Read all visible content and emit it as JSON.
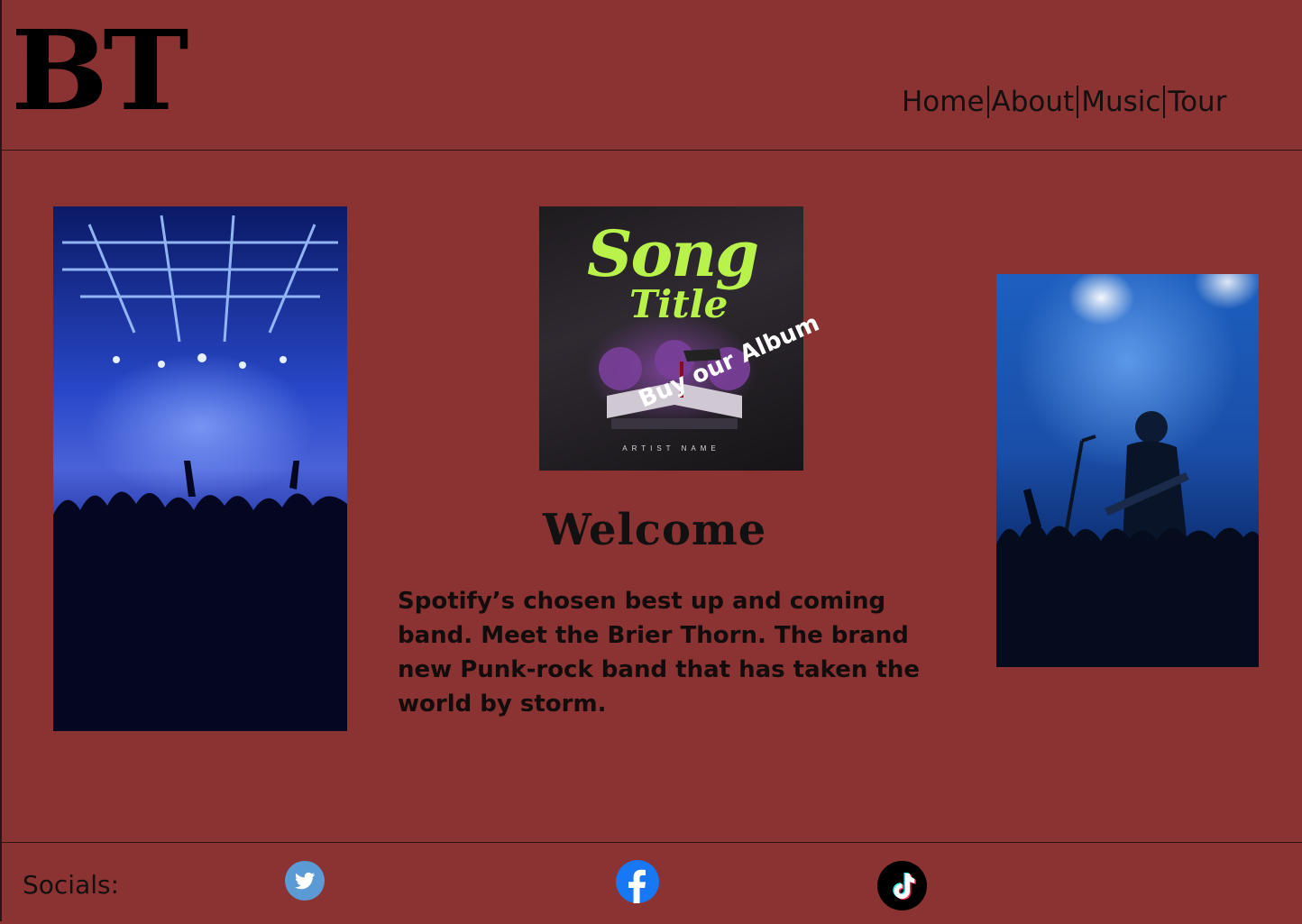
{
  "header": {
    "logo_text": "BT",
    "nav": [
      {
        "label": "Home"
      },
      {
        "label": "About"
      },
      {
        "label": "Music"
      },
      {
        "label": "Tour"
      }
    ]
  },
  "album": {
    "title_line1": "Song",
    "title_line2": "Title",
    "artist": "ARTIST NAME",
    "buy_label": "Buy our Album"
  },
  "main": {
    "welcome": "Welcome",
    "intro": "Spotify’s chosen best up and coming band. Meet the Brier Thorn. The brand new Punk-rock band that has taken the world by storm."
  },
  "footer": {
    "socials_label": "Socials:",
    "icons": [
      "twitter-icon",
      "facebook-icon",
      "tiktok-icon"
    ]
  },
  "colors": {
    "background": "#8b3232",
    "album_title": "#b8f24a",
    "text": "#111111"
  }
}
